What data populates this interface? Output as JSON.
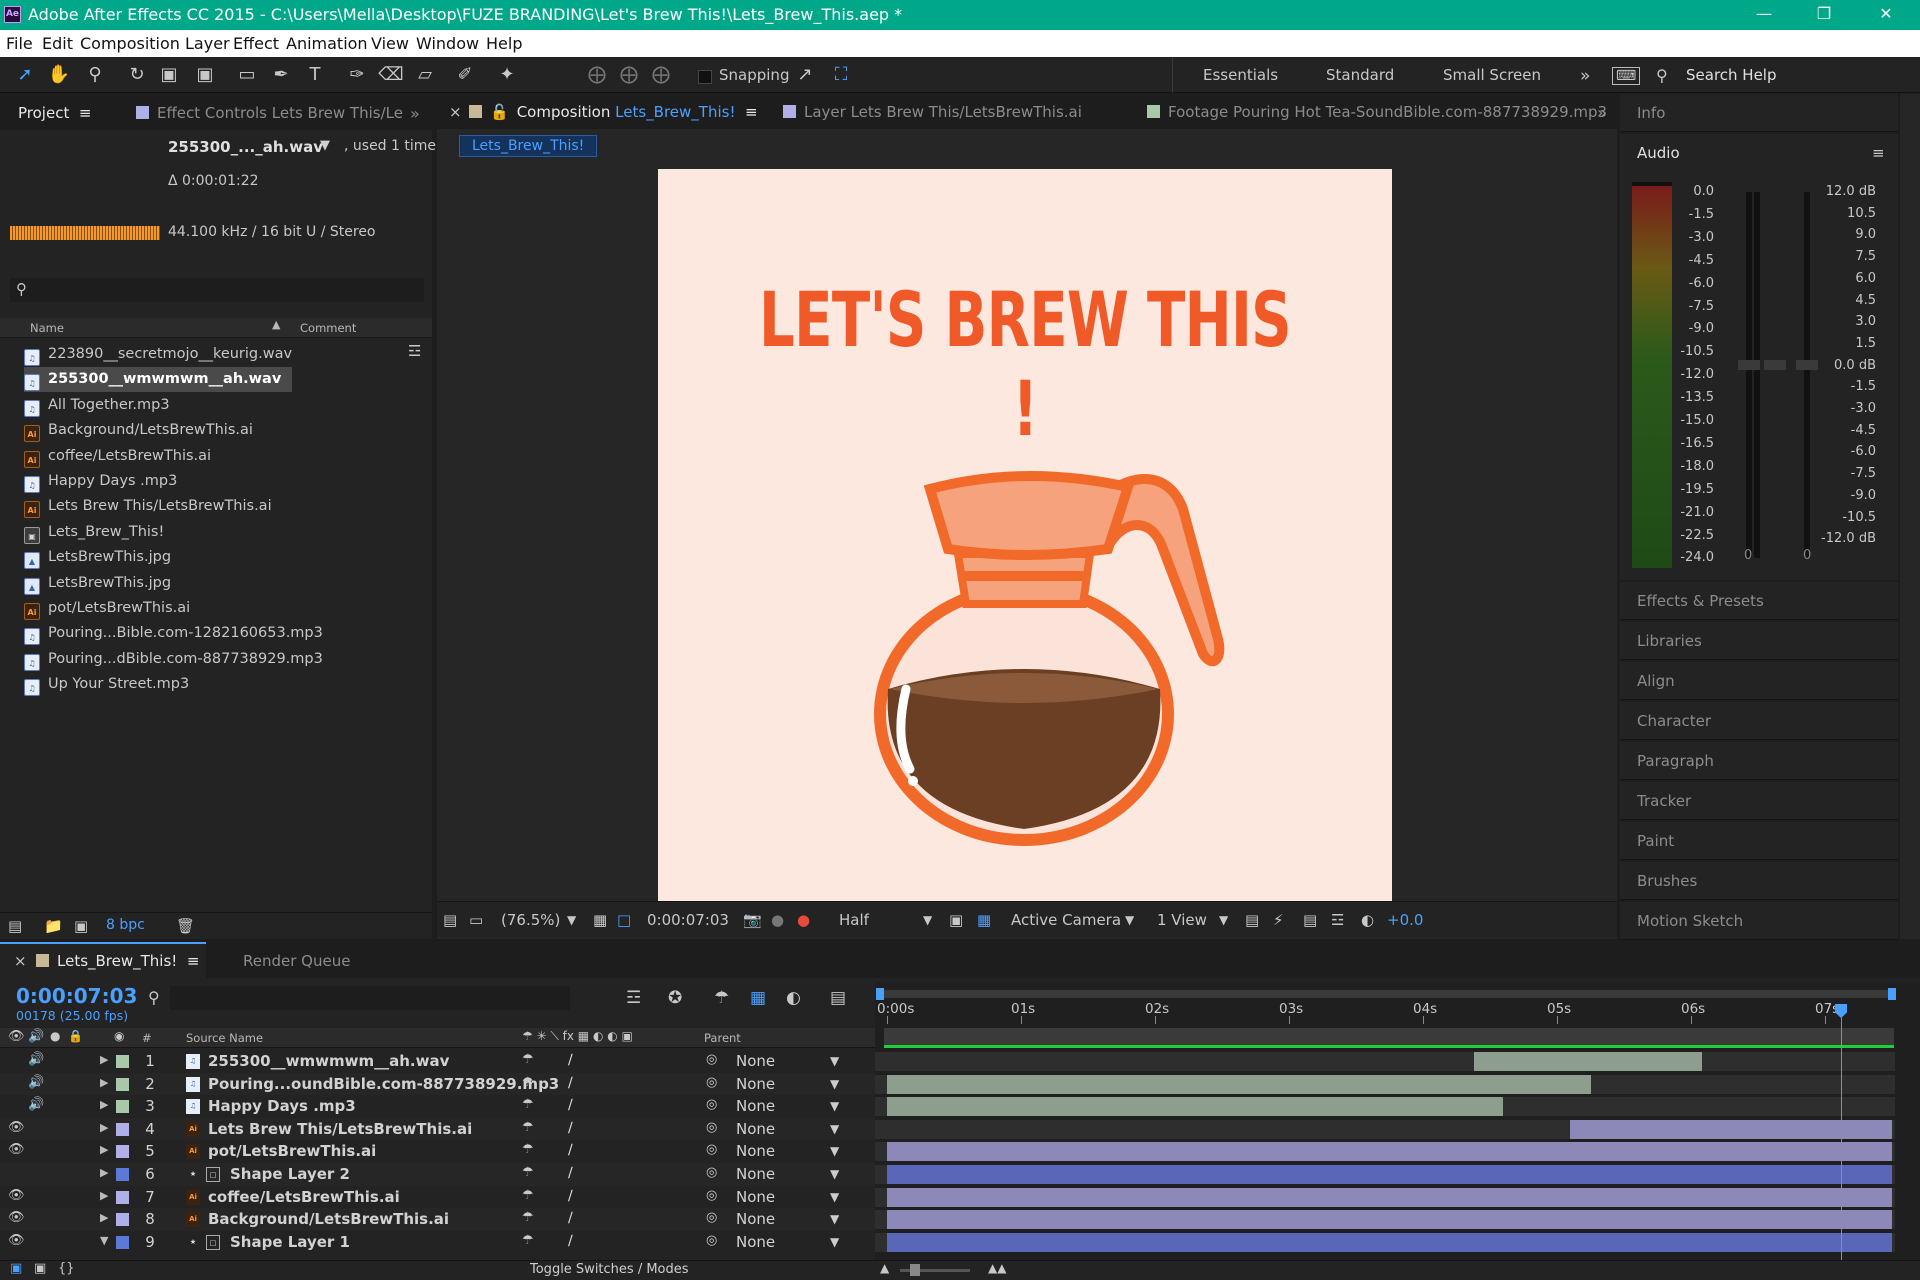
{
  "window": {
    "title": "Adobe After Effects CC 2015 - C:\\Users\\Mella\\Desktop\\FUZE BRANDING\\Let's Brew This!\\Lets_Brew_This.aep *",
    "app_badge": "Ae"
  },
  "menu": [
    "File",
    "Edit",
    "Composition",
    "Layer",
    "Effect",
    "Animation",
    "View",
    "Window",
    "Help"
  ],
  "toolbar": {
    "snapping_label": "Snapping",
    "workspaces": [
      "Essentials",
      "Standard",
      "Small Screen"
    ],
    "search_help": "Search Help"
  },
  "project_panel": {
    "tab_project": "Project",
    "tab_effect_controls": "Effect Controls Lets Brew This/Le",
    "selected_name": "255300_..._ah.wav",
    "used": ", used 1 time",
    "duration": "Δ 0:00:01:22",
    "audio_info": "44.100 kHz / 16 bit U / Stereo",
    "col_name": "Name",
    "col_comment": "Comment",
    "bpc": "8 bpc",
    "items": [
      {
        "name": "223890__secretmojo__keurig.wav",
        "type": "audio"
      },
      {
        "name": "255300__wmwmwm__ah.wav",
        "type": "audio",
        "selected": true
      },
      {
        "name": "All Together.mp3",
        "type": "audio"
      },
      {
        "name": "Background/LetsBrewThis.ai",
        "type": "ai"
      },
      {
        "name": "coffee/LetsBrewThis.ai",
        "type": "ai"
      },
      {
        "name": "Happy Days .mp3",
        "type": "audio"
      },
      {
        "name": "Lets Brew This/LetsBrewThis.ai",
        "type": "ai"
      },
      {
        "name": "Lets_Brew_This!",
        "type": "comp"
      },
      {
        "name": "LetsBrewThis.jpg",
        "type": "img"
      },
      {
        "name": "LetsBrewThis.jpg",
        "type": "img"
      },
      {
        "name": "pot/LetsBrewThis.ai",
        "type": "ai"
      },
      {
        "name": "Pouring...Bible.com-1282160653.mp3",
        "type": "audio"
      },
      {
        "name": "Pouring...dBible.com-887738929.mp3",
        "type": "audio"
      },
      {
        "name": "Up Your Street.mp3",
        "type": "audio"
      }
    ]
  },
  "viewer": {
    "tab_composition_prefix": "Composition",
    "tab_composition_name": "Lets_Brew_This!",
    "tab_layer": "Layer Lets Brew This/LetsBrewThis.ai",
    "tab_footage": "Footage Pouring Hot Tea-SoundBible.com-887738929.mp3",
    "breadcrumb": "Lets_Brew_This!",
    "canvas_headline": "LET'S BREW THIS !",
    "zoom": "(76.5%)",
    "timecode": "0:00:07:03",
    "resolution": "Half",
    "camera": "Active Camera",
    "views": "1 View",
    "exposure": "+0.0",
    "colors": {
      "headline": "#f05a28",
      "canvas": "#fde8e0",
      "pot_orange": "#f26a2a",
      "coffee": "#6b3f23"
    }
  },
  "right_panels": {
    "info": "Info",
    "audio": "Audio",
    "audio_left_scale": [
      "0.0",
      "-1.5",
      "-3.0",
      "-4.5",
      "-6.0",
      "-7.5",
      "-9.0",
      "-10.5",
      "-12.0",
      "-13.5",
      "-15.0",
      "-16.5",
      "-18.0",
      "-19.5",
      "-21.0",
      "-22.5",
      "-24.0"
    ],
    "audio_right_scale": [
      "12.0 dB",
      "10.5",
      "9.0",
      "7.5",
      "6.0",
      "4.5",
      "3.0",
      "1.5",
      "0.0 dB",
      "-1.5",
      "-3.0",
      "-4.5",
      "-6.0",
      "-7.5",
      "-9.0",
      "-10.5",
      "-12.0 dB"
    ],
    "slider_values": [
      "0",
      "0"
    ],
    "collapsed": [
      "Effects & Presets",
      "Libraries",
      "Align",
      "Character",
      "Paragraph",
      "Tracker",
      "Paint",
      "Brushes",
      "Motion Sketch"
    ]
  },
  "timeline": {
    "tab_comp": "Lets_Brew_This!",
    "tab_render": "Render Queue",
    "timecode": "0:00:07:03",
    "frame_info": "00178 (25.00 fps)",
    "col_source": "Source Name",
    "col_parent": "Parent",
    "col_num": "#",
    "toggle_label": "Toggle Switches / Modes",
    "ruler": [
      "0:00s",
      "01s",
      "02s",
      "03s",
      "04s",
      "05s",
      "06s",
      "07s"
    ],
    "playhead_seconds": 7.12,
    "layers": [
      {
        "num": "1",
        "name": "255300__wmwmwm__ah.wav",
        "type": "audio",
        "label": "#a8c8a8",
        "parent": "None",
        "start": 4.38,
        "end": 6.08,
        "bar": "#8e9e8e",
        "av": "audio"
      },
      {
        "num": "2",
        "name": "Pouring...oundBible.com-887738929.mp3",
        "type": "audio",
        "label": "#a8c8a8",
        "parent": "None",
        "start": 0.0,
        "end": 5.25,
        "bar": "#8e9e8e",
        "av": "audio"
      },
      {
        "num": "3",
        "name": "Happy Days .mp3",
        "type": "audio",
        "label": "#a8c8a8",
        "parent": "None",
        "start": 0.0,
        "end": 4.6,
        "bar": "#8e9e8e",
        "av": "audio"
      },
      {
        "num": "4",
        "name": "Lets Brew This/LetsBrewThis.ai",
        "type": "ai",
        "label": "#b0b0e8",
        "parent": "None",
        "start": 5.1,
        "end": 7.5,
        "bar": "#8c88b8",
        "av": "video"
      },
      {
        "num": "5",
        "name": "pot/LetsBrewThis.ai",
        "type": "ai",
        "label": "#b0b0e8",
        "parent": "None",
        "start": 0.0,
        "end": 7.5,
        "bar": "#8c88b8",
        "av": "video"
      },
      {
        "num": "6",
        "name": "Shape Layer 2",
        "type": "shape",
        "label": "#5b7ad8",
        "parent": "None",
        "start": 0.0,
        "end": 7.5,
        "bar": "#5a66b8",
        "av": "none"
      },
      {
        "num": "7",
        "name": "coffee/LetsBrewThis.ai",
        "type": "ai",
        "label": "#b0b0e8",
        "parent": "None",
        "start": 0.0,
        "end": 7.5,
        "bar": "#8c88b8",
        "av": "video"
      },
      {
        "num": "8",
        "name": "Background/LetsBrewThis.ai",
        "type": "ai",
        "label": "#b0b0e8",
        "parent": "None",
        "start": 0.0,
        "end": 7.5,
        "bar": "#8c88b8",
        "av": "video"
      },
      {
        "num": "9",
        "name": "Shape Layer 1",
        "type": "shape",
        "label": "#5b7ad8",
        "parent": "None",
        "start": 0.0,
        "end": 7.5,
        "bar": "#5a66b8",
        "av": "video"
      }
    ]
  }
}
